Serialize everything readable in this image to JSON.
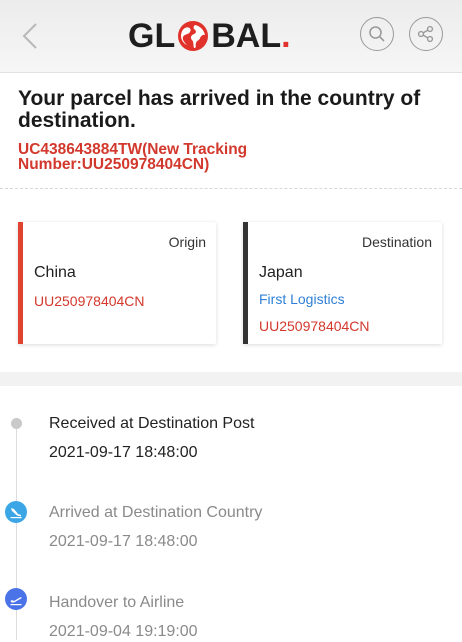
{
  "header": {
    "logo_text": "GL",
    "logo_text_end": "BAL",
    "logo_dot": "."
  },
  "status": {
    "headline": "Your parcel has arrived in the country of destination.",
    "tracking": "UC438643884TW(New Tracking Number:UU250978404CN)"
  },
  "origin": {
    "heading": "Origin",
    "country": "China",
    "number": "UU250978404CN"
  },
  "destination": {
    "heading": "Destination",
    "country": "Japan",
    "carrier": "First Logistics",
    "number": "UU250978404CN"
  },
  "events": [
    {
      "title": "Received at Destination Post",
      "time": "2021-09-17 18:48:00"
    },
    {
      "title": "Arrived at Destination Country",
      "time": "2021-09-17 18:48:00"
    },
    {
      "title": "Handover to Airline",
      "time": "2021-09-04 19:19:00"
    }
  ],
  "colors": {
    "accent_red": "#d2382c",
    "origin_bar": "#e0432f",
    "destination_bar": "#333333",
    "link_blue": "#2f7fd6",
    "arrival_icon": "#3aa6e6",
    "airline_icon": "#4a73e8"
  },
  "icons": {
    "back": "chevron-left-icon",
    "search": "search-icon",
    "share": "share-icon",
    "arrival": "plane-landing-icon",
    "airline": "plane-takeoff-icon"
  }
}
